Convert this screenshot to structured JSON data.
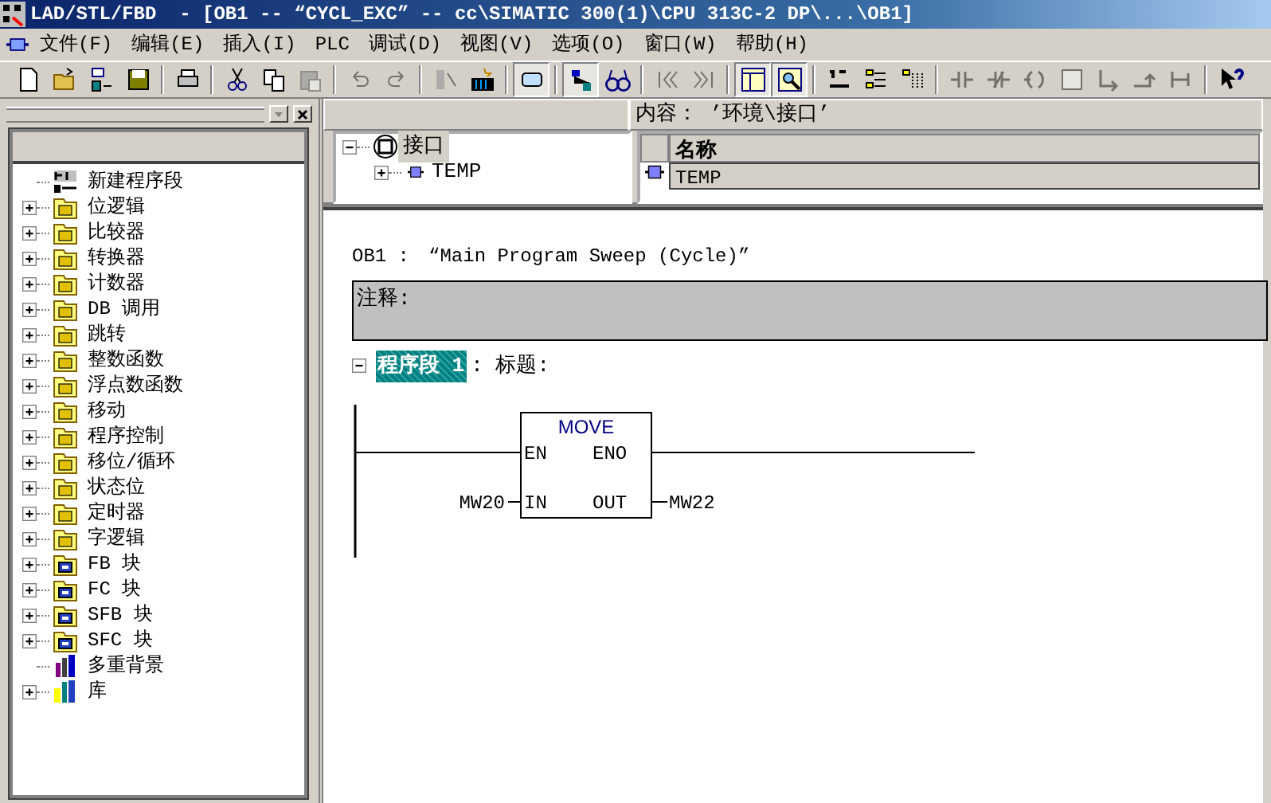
{
  "window": {
    "title": "LAD/STL/FBD  - [OB1 -- “CYCL_EXC” -- cc\\SIMATIC 300(1)\\CPU 313C-2 DP\\...\\OB1]"
  },
  "menu": [
    "文件(F)",
    "编辑(E)",
    "插入(I)",
    "PLC",
    "调试(D)",
    "视图(V)",
    "选项(O)",
    "窗口(W)",
    "帮助(H)"
  ],
  "toolbar": [
    {
      "kind": "new",
      "disabled": false,
      "pressed": false
    },
    {
      "kind": "open",
      "disabled": false,
      "pressed": false
    },
    {
      "kind": "download",
      "disabled": false,
      "pressed": false
    },
    {
      "kind": "save",
      "disabled": false,
      "pressed": false
    },
    {
      "kind": "sep"
    },
    {
      "kind": "print",
      "disabled": false,
      "pressed": false
    },
    {
      "kind": "sep"
    },
    {
      "kind": "cut",
      "disabled": false,
      "pressed": false
    },
    {
      "kind": "copy",
      "disabled": false,
      "pressed": false
    },
    {
      "kind": "paste",
      "disabled": true,
      "pressed": false
    },
    {
      "kind": "sep"
    },
    {
      "kind": "undo",
      "disabled": true,
      "pressed": false
    },
    {
      "kind": "redo",
      "disabled": true,
      "pressed": false
    },
    {
      "kind": "sep"
    },
    {
      "kind": "module",
      "disabled": true,
      "pressed": false
    },
    {
      "kind": "monitor",
      "disabled": false,
      "pressed": false
    },
    {
      "kind": "sep"
    },
    {
      "kind": "window",
      "disabled": false,
      "pressed": true
    },
    {
      "kind": "sep"
    },
    {
      "kind": "network",
      "disabled": false,
      "pressed": true
    },
    {
      "kind": "glasses",
      "disabled": false,
      "pressed": false
    },
    {
      "kind": "sep"
    },
    {
      "kind": "first",
      "disabled": true,
      "pressed": false
    },
    {
      "kind": "last",
      "disabled": true,
      "pressed": false
    },
    {
      "kind": "sep"
    },
    {
      "kind": "panel",
      "disabled": false,
      "pressed": true
    },
    {
      "kind": "zoom",
      "disabled": false,
      "pressed": true
    },
    {
      "kind": "sep"
    },
    {
      "kind": "newnet",
      "disabled": false,
      "pressed": false
    },
    {
      "kind": "list",
      "disabled": false,
      "pressed": false
    },
    {
      "kind": "list2",
      "disabled": false,
      "pressed": false
    },
    {
      "kind": "sep"
    },
    {
      "kind": "no",
      "disabled": true,
      "pressed": false
    },
    {
      "kind": "nc",
      "disabled": true,
      "pressed": false
    },
    {
      "kind": "coil",
      "disabled": true,
      "pressed": false
    },
    {
      "kind": "boxq",
      "disabled": true,
      "pressed": false
    },
    {
      "kind": "branchopen",
      "disabled": true,
      "pressed": false
    },
    {
      "kind": "branchclose",
      "disabled": true,
      "pressed": false
    },
    {
      "kind": "connector",
      "disabled": true,
      "pressed": false
    },
    {
      "kind": "sep"
    },
    {
      "kind": "help",
      "disabled": false,
      "pressed": false
    }
  ],
  "catalog": {
    "items": [
      {
        "label": "新建程序段",
        "kind": "network",
        "expandable": false
      },
      {
        "label": "位逻辑",
        "kind": "folder",
        "expandable": true
      },
      {
        "label": "比较器",
        "kind": "folder",
        "expandable": true
      },
      {
        "label": "转换器",
        "kind": "folder",
        "expandable": true
      },
      {
        "label": "计数器",
        "kind": "folder",
        "expandable": true
      },
      {
        "label": "DB 调用",
        "kind": "folder",
        "expandable": true
      },
      {
        "label": "跳转",
        "kind": "folder",
        "expandable": true
      },
      {
        "label": "整数函数",
        "kind": "folder",
        "expandable": true
      },
      {
        "label": "浮点数函数",
        "kind": "folder",
        "expandable": true
      },
      {
        "label": "移动",
        "kind": "folder",
        "expandable": true
      },
      {
        "label": "程序控制",
        "kind": "folder",
        "expandable": true
      },
      {
        "label": "移位/循环",
        "kind": "folder",
        "expandable": true
      },
      {
        "label": "状态位",
        "kind": "folder",
        "expandable": true
      },
      {
        "label": "定时器",
        "kind": "folder",
        "expandable": true
      },
      {
        "label": "字逻辑",
        "kind": "folder",
        "expandable": true
      },
      {
        "label": "FB 块",
        "kind": "block",
        "expandable": true
      },
      {
        "label": "FC 块",
        "kind": "block",
        "expandable": true
      },
      {
        "label": "SFB 块",
        "kind": "block",
        "expandable": true
      },
      {
        "label": "SFC 块",
        "kind": "block",
        "expandable": true
      },
      {
        "label": "多重背景",
        "kind": "books",
        "expandable": false
      },
      {
        "label": "库",
        "kind": "library",
        "expandable": true
      }
    ]
  },
  "interface": {
    "content": "内容： ’环境\\接口’",
    "tree": [
      {
        "label": "接口",
        "selected": true,
        "expanded": true,
        "children": [
          {
            "label": "TEMP",
            "selected": false,
            "expanded": false
          }
        ]
      }
    ],
    "table": {
      "columns": [
        "名称"
      ],
      "rows": [
        [
          "TEMP"
        ]
      ]
    }
  },
  "block": {
    "label": "OB1 :",
    "title": "“Main Program Sweep (Cycle)”",
    "comment_label": "注释:"
  },
  "network": {
    "label": "程序段 1",
    "title_label": ": 标题:",
    "expanded": true,
    "box": {
      "name": "MOVE",
      "en": "EN",
      "eno": "ENO",
      "in": "IN",
      "out": "OUT",
      "in_operand": "MW20",
      "out_operand": "MW22"
    }
  }
}
